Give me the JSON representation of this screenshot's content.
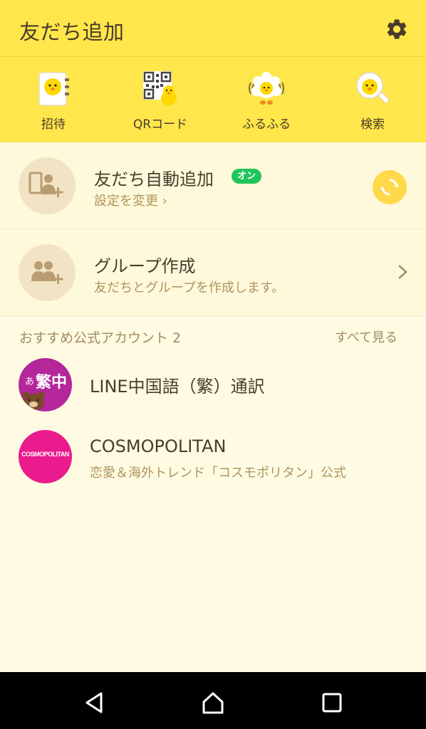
{
  "header": {
    "title": "友だち追加",
    "settings_icon": "gear-icon"
  },
  "menu": {
    "items": [
      {
        "label": "招待",
        "icon": "invite-icon"
      },
      {
        "label": "QRコード",
        "icon": "qr-code-icon"
      },
      {
        "label": "ふるふる",
        "icon": "shake-icon"
      },
      {
        "label": "検索",
        "icon": "search-icon"
      }
    ]
  },
  "auto_add": {
    "title": "友だち自動追加",
    "badge": "オン",
    "subtitle": "設定を変更 ›",
    "icon": "add-phone-contact-icon",
    "action_icon": "sync-icon"
  },
  "group_create": {
    "title": "グループ作成",
    "subtitle": "友だちとグループを作成します。",
    "icon": "add-group-icon"
  },
  "recommended": {
    "header": "おすすめ公式アカウント 2",
    "see_all": "すべて見る",
    "accounts": [
      {
        "name": "LINE中国語（繁）通訳",
        "description": "",
        "avatar_text_small": "あ",
        "avatar_text": "繁中",
        "avatar_color": "#b5269b"
      },
      {
        "name": "COSMOPOLITAN",
        "description": "恋愛＆海外トレンド「コスモポリタン」公式",
        "avatar_text": "COSMOPOLITAN",
        "avatar_color": "#ea1b8c"
      }
    ]
  },
  "colors": {
    "header_bg": "#ffe64a",
    "page_bg": "#fffbe3",
    "badge_green": "#20c55a"
  }
}
